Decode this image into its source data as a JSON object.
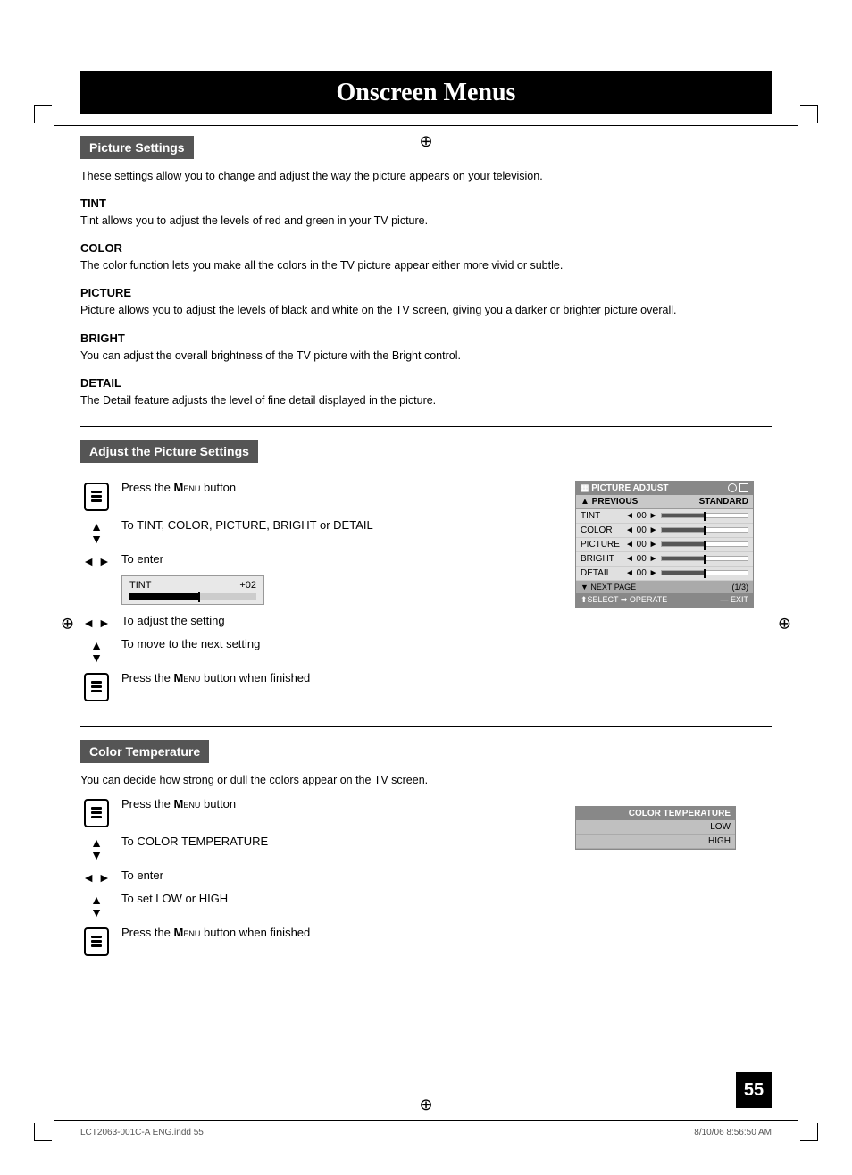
{
  "page": {
    "title": "Onscreen Menus",
    "number": "55",
    "footer_left": "LCT2063-001C-A ENG.indd   55",
    "footer_right": "8/10/06   8:56:50 AM"
  },
  "sections": {
    "picture_settings": {
      "header": "Picture Settings",
      "intro": "These settings allow you to change and adjust the way the picture appears on your television.",
      "items": [
        {
          "heading": "TINT",
          "text": "Tint allows you to adjust the levels of red and green in your TV picture."
        },
        {
          "heading": "COLOR",
          "text": "The color function lets you make all the colors in the TV picture appear either more vivid or subtle."
        },
        {
          "heading": "PICTURE",
          "text": "Picture allows you to adjust the levels of black and white on the TV screen, giving you a darker or brighter picture overall."
        },
        {
          "heading": "BRIGHT",
          "text": "You can adjust the overall brightness of the TV picture with the Bright control."
        },
        {
          "heading": "DETAIL",
          "text": "The Detail feature adjusts the level of fine detail displayed in the picture."
        }
      ]
    },
    "adjust_picture": {
      "header": "Adjust the Picture Settings",
      "steps": [
        {
          "icon": "menu",
          "text": "Press the Menu button"
        },
        {
          "icon": "updown",
          "text": "To TINT, COLOR, PICTURE, BRIGHT or DETAIL"
        },
        {
          "icon": "leftright",
          "text": "To enter"
        },
        {
          "icon": "leftright",
          "text": "To adjust the setting"
        },
        {
          "icon": "updown",
          "text": "To move to the next setting"
        },
        {
          "icon": "menu",
          "text": "Press the Menu button when finished"
        }
      ],
      "tint_demo": {
        "label": "TINT",
        "value": "+02"
      },
      "screen": {
        "title": "PICTURE ADJUST",
        "prev": "▲ PREVIOUS",
        "mode": "STANDARD",
        "rows": [
          {
            "label": "TINT",
            "value": "◄ 00 ►",
            "fill": 50
          },
          {
            "label": "COLOR",
            "value": "◄ 00 ►",
            "fill": 50
          },
          {
            "label": "PICTURE",
            "value": "◄ 00 ►",
            "fill": 50
          },
          {
            "label": "BRIGHT",
            "value": "◄ 00 ►",
            "fill": 50
          },
          {
            "label": "DETAIL",
            "value": "◄ 00 ►",
            "fill": 50
          }
        ],
        "next_page": "▼ NEXT PAGE",
        "page_num": "(1/3)",
        "footer_left": "⬆SELECT ➡ OPERATE",
        "footer_right": "— EXIT"
      }
    },
    "color_temperature": {
      "header": "Color Temperature",
      "intro": "You can decide how strong or dull the colors appear on the TV screen.",
      "steps": [
        {
          "icon": "menu",
          "text": "Press the Menu button"
        },
        {
          "icon": "updown",
          "text": "To COLOR TEMPERATURE"
        },
        {
          "icon": "leftright",
          "text": "To enter"
        },
        {
          "icon": "updown",
          "text": "To set LOW or HIGH"
        },
        {
          "icon": "menu",
          "text": "Press the Menu button when finished"
        }
      ],
      "screen": {
        "title": "COLOR TEMPERATURE",
        "options": [
          {
            "label": "LOW",
            "selected": false
          },
          {
            "label": "HIGH",
            "selected": false
          }
        ]
      }
    }
  }
}
